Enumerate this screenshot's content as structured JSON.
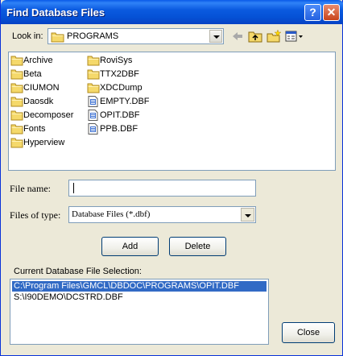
{
  "window": {
    "title": "Find Database Files",
    "help_glyph": "?",
    "close_glyph": "✕"
  },
  "lookin": {
    "label": "Look in:",
    "value": "PROGRAMS",
    "tools": [
      "back-arrow-icon",
      "up-folder-icon",
      "new-folder-icon",
      "view-menu-icon"
    ]
  },
  "files": {
    "column1": [
      {
        "name": "Archive",
        "type": "folder"
      },
      {
        "name": "Beta",
        "type": "folder"
      },
      {
        "name": "CIUMON",
        "type": "folder"
      },
      {
        "name": "Daosdk",
        "type": "folder"
      },
      {
        "name": "Decomposer",
        "type": "folder"
      },
      {
        "name": "Fonts",
        "type": "folder"
      },
      {
        "name": "Hyperview",
        "type": "folder"
      }
    ],
    "column2": [
      {
        "name": "RoviSys",
        "type": "folder"
      },
      {
        "name": "TTX2DBF",
        "type": "folder"
      },
      {
        "name": "XDCDump",
        "type": "folder"
      },
      {
        "name": "EMPTY.DBF",
        "type": "file"
      },
      {
        "name": "OPIT.DBF",
        "type": "file"
      },
      {
        "name": "PPB.DBF",
        "type": "file"
      }
    ]
  },
  "filename": {
    "label": "File name:",
    "value": ""
  },
  "filetype": {
    "label": "Files of type:",
    "value": "Database Files (*.dbf)"
  },
  "buttons": {
    "add": "Add",
    "delete": "Delete",
    "close": "Close"
  },
  "selection": {
    "label": "Current Database File Selection:",
    "items": [
      "C:\\Program Files\\GMCL\\DBDOC\\PROGRAMS\\OPIT.DBF",
      "S:\\I90DEMO\\DCSTRD.DBF"
    ],
    "selected_index": 0
  },
  "colors": {
    "titlebar": "#0552d6",
    "selection": "#316ac5",
    "folder": "#f5d96b"
  }
}
